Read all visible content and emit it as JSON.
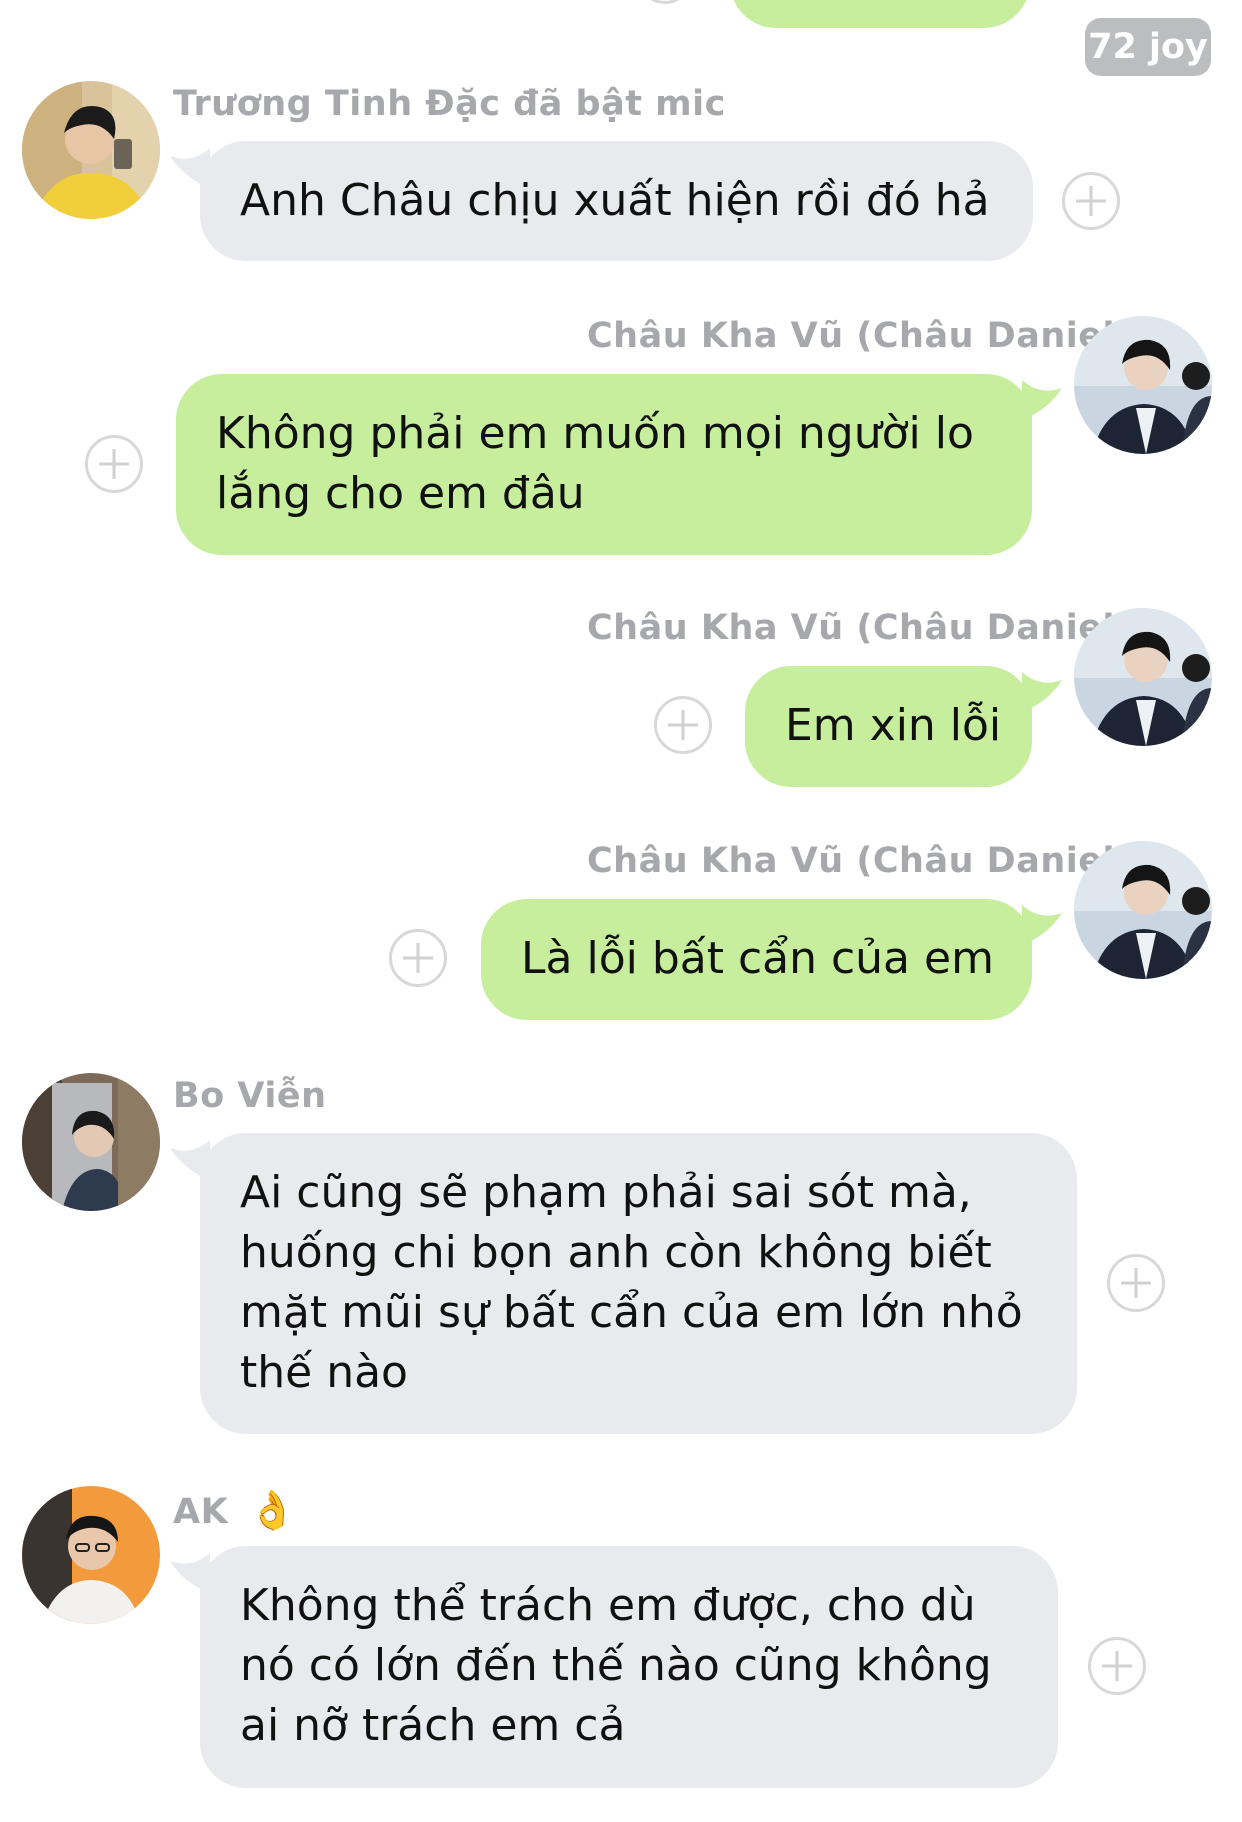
{
  "read_badge": "72 joy",
  "messages": [
    {
      "sender": "Trương Tinh Đặc đã bật mic",
      "side": "left",
      "lines": [
        "Anh Châu chịu xuất hiện rồi đó hả"
      ],
      "avatar": "avatar-truong-tinh-dac"
    },
    {
      "sender": "Châu Kha Vũ (Châu Daniel)",
      "side": "right",
      "lines": [
        "Không phải em muốn mọi người lo",
        "lắng cho em đâu"
      ],
      "avatar": "avatar-chau-kha-vu"
    },
    {
      "sender": "Châu Kha Vũ (Châu Daniel)",
      "side": "right",
      "lines": [
        "Em xin lỗi"
      ],
      "avatar": "avatar-chau-kha-vu"
    },
    {
      "sender": "Châu Kha Vũ (Châu Daniel)",
      "side": "right",
      "lines": [
        "Là lỗi bất cẩn của em"
      ],
      "avatar": "avatar-chau-kha-vu"
    },
    {
      "sender": "Bo Viễn",
      "side": "left",
      "lines": [
        "Ai cũng sẽ phạm phải sai sót mà,",
        "huống chi bọn anh còn không biết",
        "mặt mũi sự bất cẩn của em lớn nhỏ",
        "thế nào"
      ],
      "avatar": "avatar-bo-vien"
    },
    {
      "sender": "AK",
      "sender_emoji": "👌",
      "side": "left",
      "lines": [
        "Không thể trách em được, cho dù",
        "nó có lớn đến thế nào cũng không",
        "ai nỡ trách em cả"
      ],
      "avatar": "avatar-ak"
    }
  ],
  "colors": {
    "incoming_bubble": "#e8eaed",
    "outgoing_bubble": "#c6ee9d",
    "sender_name": "#a6a8ab",
    "badge": "#bcbdbf"
  }
}
